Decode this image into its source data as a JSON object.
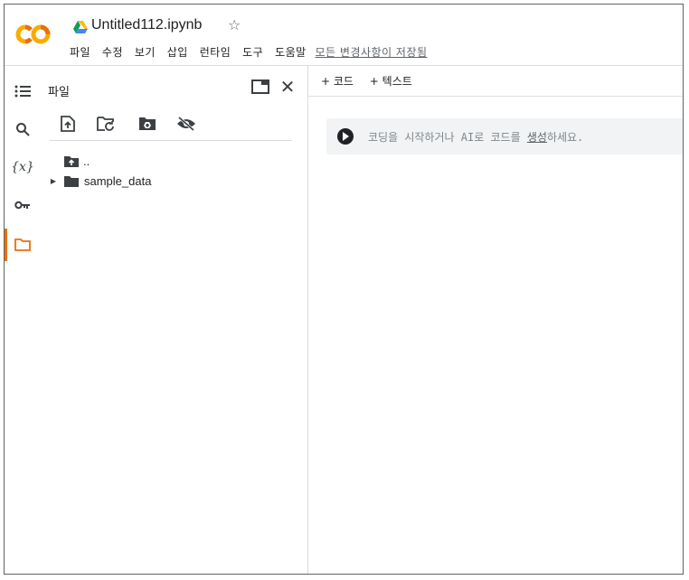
{
  "header": {
    "notebook_title": "Untitled112.ipynb",
    "star_icon": "star-outline-icon",
    "logo": "colab-logo",
    "menu": [
      "파일",
      "수정",
      "보기",
      "삽입",
      "런타임",
      "도구",
      "도움말"
    ],
    "save_status": "모든 변경사항이 저장됨"
  },
  "rail": {
    "items": [
      "toc-icon",
      "search-icon",
      "variables-icon",
      "key-icon",
      "folder-icon"
    ],
    "variables_glyph": "{x}",
    "active": "folder-icon",
    "accent_color": "#e8710a"
  },
  "file_panel": {
    "title": "파일",
    "toolbar": [
      "upload-file-icon",
      "refresh-icon",
      "mount-drive-icon",
      "hide-icon"
    ],
    "tree": {
      "parent_label": "..",
      "folder_label": "sample_data"
    }
  },
  "notebook": {
    "toolbar": {
      "add_code": "+ 코드",
      "add_text": "+ 텍스트"
    },
    "cell": {
      "placeholder_prefix": "코딩을 시작하거나 AI로 코드를 ",
      "placeholder_link": "생성",
      "placeholder_suffix": "하세요."
    }
  }
}
